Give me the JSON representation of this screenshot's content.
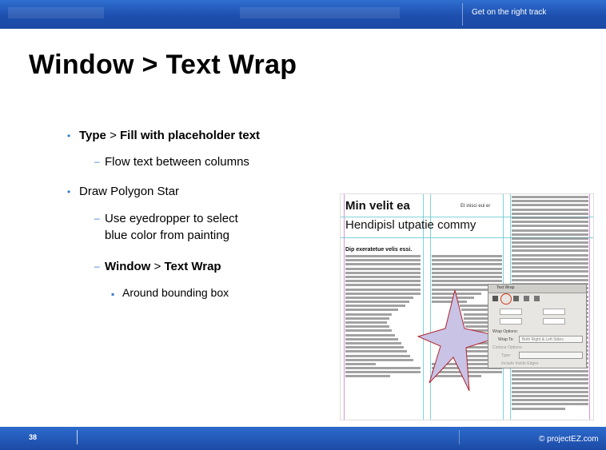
{
  "header": {
    "tagline": "Get on the right track"
  },
  "slide": {
    "title": "Window > Text Wrap",
    "bullets": {
      "b1_bold1": "Type",
      "b1_sep": " > ",
      "b1_bold2": "Fill with placeholder text",
      "b1_sub": "Flow text between columns",
      "b2": "Draw Polygon Star",
      "b2_sub1_line1": "Use eyedropper to select",
      "b2_sub1_line2": "blue color from painting",
      "b2_sub2_bold1": "Window",
      "b2_sub2_sep": " > ",
      "b2_sub2_bold2": "Text Wrap",
      "b2_sub2_sub": "Around bounding box"
    }
  },
  "screenshot": {
    "heading": "Min velit ea",
    "side_note": "Et inisci eui er",
    "subheading": "Hendipisl utpatie commy",
    "section_title": "Dip exeratetue velis essi.",
    "panel_title": "Text Wrap",
    "panel_wrap_options": "Wrap Options:",
    "panel_wrap_to": "Wrap To:",
    "panel_wrap_to_value": "Both Right & Left Sides",
    "panel_contour_options": "Contour Options:",
    "panel_type": "Type:",
    "panel_include": "Include Inside Edges",
    "star_color": "#c9c3e6"
  },
  "footer": {
    "page_number": "38",
    "copyright": "© projectEZ.com"
  },
  "colors": {
    "bar": "#1d4fae",
    "bullet": "#3a78c8"
  }
}
